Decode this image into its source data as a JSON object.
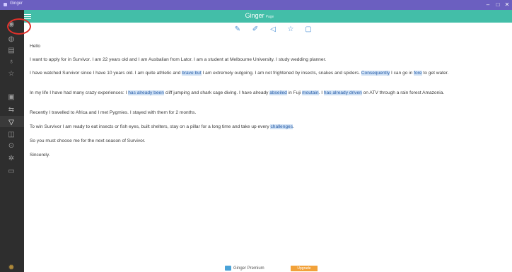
{
  "window": {
    "title": "Ginger",
    "minimize": "–",
    "maximize": "□",
    "close": "✕"
  },
  "header": {
    "brand": "Ginger",
    "brand_suffix": "Page"
  },
  "rail_items": [
    {
      "name": "ginger-logo-icon",
      "glyph": "◉"
    },
    {
      "name": "globe-icon",
      "glyph": "◍"
    },
    {
      "name": "document-icon",
      "glyph": "▤"
    },
    {
      "name": "microphone-icon",
      "glyph": "♁"
    },
    {
      "name": "star-icon",
      "glyph": "☆"
    },
    {
      "name": "file-icon",
      "glyph": "▣"
    },
    {
      "name": "translate-icon",
      "glyph": "⇆"
    },
    {
      "name": "chat-icon",
      "glyph": "▽"
    },
    {
      "name": "book-icon",
      "glyph": "◫"
    },
    {
      "name": "play-icon",
      "glyph": "⊙"
    },
    {
      "name": "gear-icon",
      "glyph": "✲"
    },
    {
      "name": "comment-icon",
      "glyph": "▭"
    }
  ],
  "toolbar": [
    {
      "name": "edit-icon",
      "glyph": "✎"
    },
    {
      "name": "pen-icon",
      "glyph": "✐"
    },
    {
      "name": "speaker-icon",
      "glyph": "◁"
    },
    {
      "name": "favorite-icon",
      "glyph": "☆"
    },
    {
      "name": "clipboard-icon",
      "glyph": "▢"
    }
  ],
  "document": {
    "greeting": "Hello",
    "p1": "I want to apply for in Survivor. I am 22 years old and I am Ausbalian from Lator. I am a student at Melbourne University. I study wedding planner.",
    "p2": [
      {
        "t": "I have watched Survivor since I have 10 years old. I am quite athletic and "
      },
      {
        "t": "brave but",
        "h": true
      },
      {
        "t": " I am extremely outgoing. I am not frightened by insects, snakes and spiders. "
      },
      {
        "t": "Consequently",
        "h": true
      },
      {
        "t": " I can go in "
      },
      {
        "t": "fore",
        "h": true
      },
      {
        "t": " to get water."
      }
    ],
    "p3": [
      {
        "t": "In my life I have had many crazy experiences: I "
      },
      {
        "t": "has already been",
        "h": true
      },
      {
        "t": " cliff jumping and shark cage diving. I have already "
      },
      {
        "t": "abseiled",
        "h": true
      },
      {
        "t": " in Fuji "
      },
      {
        "t": "moutain",
        "h": true
      },
      {
        "t": ". I "
      },
      {
        "t": "has already driven",
        "h": true
      },
      {
        "t": " on ATV through a rain forest Amazonia."
      }
    ],
    "p4": "Recently I travelled to Africa and I met Pygmies. I stayed with them for 2 months.",
    "p5": [
      {
        "t": "To win Survivor I am ready to eat insects or fish eyes, built shelters, stay on a pillar for a long time and take up every "
      },
      {
        "t": "challenges",
        "h": true
      },
      {
        "t": "."
      }
    ],
    "p6": "So you must choose me for the next season of Survivor.",
    "closing": "Sincerely."
  },
  "footer": {
    "premium_label": "Ginger Premium",
    "upgrade_label": "Upgrade"
  }
}
